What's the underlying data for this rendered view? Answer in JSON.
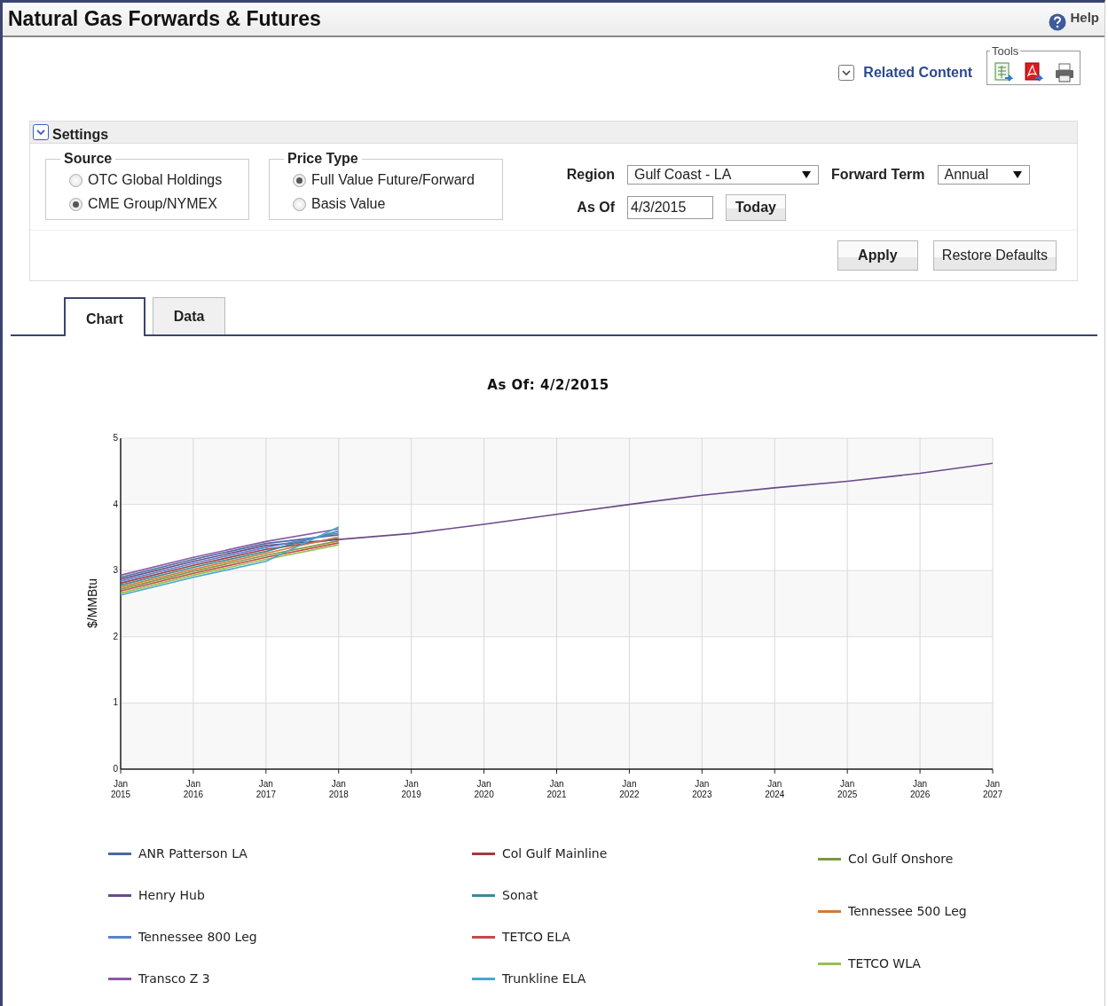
{
  "header": {
    "title": "Natural Gas Forwards & Futures",
    "help": "Help"
  },
  "toolbar": {
    "related_content": "Related Content",
    "tools_label": "Tools"
  },
  "settings": {
    "title": "Settings",
    "expanded": true,
    "groups": [
      {
        "label": "Source",
        "options": [
          {
            "label": "OTC Global Holdings",
            "selected": false
          },
          {
            "label": "CME Group/NYMEX",
            "selected": true
          }
        ]
      },
      {
        "label": "Price Type",
        "options": [
          {
            "label": "Full Value Future/Forward",
            "selected": true
          },
          {
            "label": "Basis Value",
            "selected": false
          }
        ]
      }
    ],
    "region": {
      "label": "Region",
      "value": "Gulf Coast - LA"
    },
    "forward_term": {
      "label": "Forward Term",
      "value": "Annual"
    },
    "as_of": {
      "label": "As Of",
      "value": "4/3/2015"
    },
    "today_button": "Today",
    "apply_button": "Apply",
    "restore_button": "Restore Defaults"
  },
  "tabs": [
    {
      "label": "Chart",
      "selected": true
    },
    {
      "label": "Data",
      "selected": false
    }
  ],
  "chart": {
    "chart_data": {
      "type": "line",
      "title": "As Of: 4/2/2015",
      "ylabel": "$/MMBtu",
      "grid": true,
      "categories": [
        "Jan 2015",
        "Jan 2016",
        "Jan 2017",
        "Jan 2018",
        "Jan 2019",
        "Jan 2020",
        "Jan 2021",
        "Jan 2022",
        "Jan 2023",
        "Jan 2024",
        "Jan 2025",
        "Jan 2026",
        "Jan 2027"
      ],
      "ylim": [
        0,
        5
      ],
      "yticks": [
        0,
        1,
        2,
        3,
        4,
        5
      ],
      "series": [
        {
          "name": "ANR Patterson LA",
          "color": "#4a6aa0",
          "values": [
            2.9,
            3.17,
            3.41,
            3.54,
            null,
            null,
            null,
            null,
            null,
            null,
            null,
            null,
            null
          ]
        },
        {
          "name": "Col Gulf Mainline",
          "color": "#a8383b",
          "values": [
            2.81,
            3.08,
            3.32,
            3.48,
            null,
            null,
            null,
            null,
            null,
            null,
            null,
            null,
            null
          ]
        },
        {
          "name": "Col Gulf Onshore",
          "color": "#7a9a3c",
          "values": [
            2.72,
            2.99,
            3.23,
            3.45,
            null,
            null,
            null,
            null,
            null,
            null,
            null,
            null,
            null
          ]
        },
        {
          "name": "Henry Hub",
          "color": "#6a4a8a",
          "values": [
            2.87,
            3.14,
            3.38,
            3.47,
            3.56,
            3.7,
            3.85,
            4.0,
            4.14,
            4.25,
            4.35,
            4.47,
            4.62
          ]
        },
        {
          "name": "Sonat",
          "color": "#3a8a9a",
          "values": [
            2.78,
            3.05,
            3.29,
            3.6,
            null,
            null,
            null,
            null,
            null,
            null,
            null,
            null,
            null
          ]
        },
        {
          "name": "Tennessee 500 Leg",
          "color": "#d07a38",
          "values": [
            2.75,
            3.02,
            3.26,
            3.51,
            null,
            null,
            null,
            null,
            null,
            null,
            null,
            null,
            null
          ]
        },
        {
          "name": "Tennessee 800 Leg",
          "color": "#5a82c8",
          "values": [
            2.84,
            3.11,
            3.35,
            3.57,
            null,
            null,
            null,
            null,
            null,
            null,
            null,
            null,
            null
          ]
        },
        {
          "name": "TETCO ELA",
          "color": "#c84848",
          "values": [
            2.69,
            2.96,
            3.2,
            3.42,
            null,
            null,
            null,
            null,
            null,
            null,
            null,
            null,
            null
          ]
        },
        {
          "name": "TETCO WLA",
          "color": "#98c050",
          "values": [
            2.66,
            2.93,
            3.17,
            3.39,
            null,
            null,
            null,
            null,
            null,
            null,
            null,
            null,
            null
          ]
        },
        {
          "name": "Transco Z 3",
          "color": "#8a5aa8",
          "values": [
            2.93,
            3.2,
            3.44,
            3.63,
            null,
            null,
            null,
            null,
            null,
            null,
            null,
            null,
            null
          ]
        },
        {
          "name": "Trunkline ELA",
          "color": "#48a8d0",
          "values": [
            2.63,
            2.9,
            3.14,
            3.66,
            null,
            null,
            null,
            null,
            null,
            null,
            null,
            null,
            null
          ]
        }
      ]
    }
  }
}
